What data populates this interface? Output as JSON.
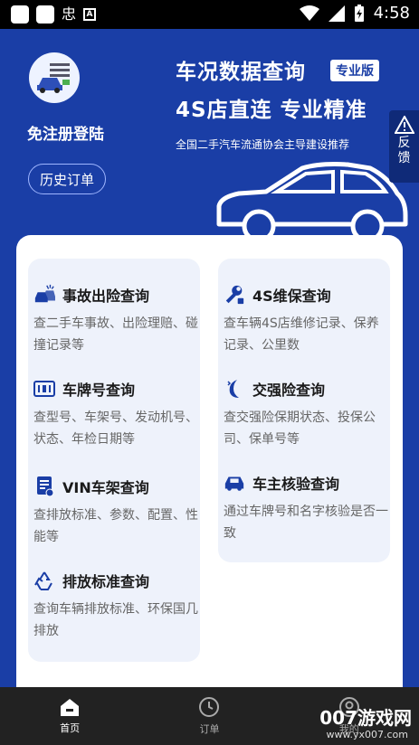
{
  "status_bar": {
    "time": "4:58"
  },
  "hero": {
    "login_label": "免注册登陆",
    "history_button": "历史订单",
    "title_line1": "车况数据查询",
    "badge": "专业版",
    "title_line2": "4S店直连 专业精准",
    "subtitle": "全国二手汽车流通协会主导建设推荐",
    "feedback_label": "反馈"
  },
  "features": {
    "left": [
      {
        "title": "事故出险查询",
        "desc": "查二手车事故、出险理赔、碰撞记录等",
        "icon": "accident-car-icon"
      },
      {
        "title": "车牌号查询",
        "desc": "查型号、车架号、发动机号、状态、年检日期等",
        "icon": "license-plate-icon"
      },
      {
        "title": "VIN车架查询",
        "desc": "查排放标准、参数、配置、性能等",
        "icon": "vin-document-icon"
      },
      {
        "title": "排放标准查询",
        "desc": "查询车辆排放标准、环保国几排放",
        "icon": "recycle-icon"
      }
    ],
    "right": [
      {
        "title": "4S维保查询",
        "desc": "查车辆4S店维修记录、保养记录、公里数",
        "icon": "wrench-icon"
      },
      {
        "title": "交强险查询",
        "desc": "查交强险保期状态、投保公司、保单号等",
        "icon": "insurance-icon"
      },
      {
        "title": "车主核验查询",
        "desc": "通过车牌号和名字核验是否一致",
        "icon": "car-owner-icon"
      }
    ]
  },
  "bottom_nav": [
    {
      "label": "首页",
      "icon": "home-icon",
      "active": true
    },
    {
      "label": "订单",
      "icon": "clock-icon",
      "active": false
    },
    {
      "label": "我的",
      "icon": "user-icon",
      "active": false
    }
  ],
  "watermark": {
    "main": "007游戏网",
    "sub": "www.yx007.com"
  },
  "colors": {
    "brand": "#1a3ea6",
    "card_bg": "#eef2fb",
    "icon": "#1a3ea6"
  }
}
